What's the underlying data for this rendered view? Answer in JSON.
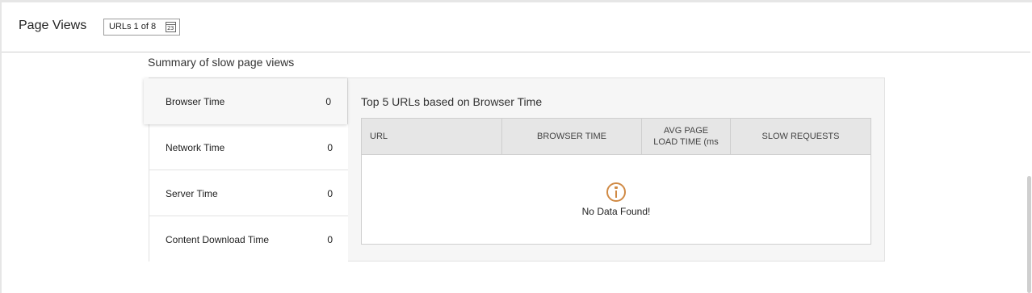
{
  "header": {
    "title": "Page Views",
    "url_selector": "URLs 1 of 8",
    "calendar_icon": "calendar-icon"
  },
  "summary": {
    "title": "Summary of slow page views",
    "metrics": [
      {
        "label": "Browser Time",
        "value": "0",
        "active": true
      },
      {
        "label": "Network Time",
        "value": "0"
      },
      {
        "label": "Server Time",
        "value": "0"
      },
      {
        "label": "Content Download Time",
        "value": "0"
      }
    ]
  },
  "table": {
    "title": "Top 5 URLs based on Browser Time",
    "columns": [
      "URL",
      "BROWSER TIME",
      "AVG PAGE\nLOAD TIME (ms",
      "SLOW REQUESTS"
    ],
    "rows": [],
    "empty_message": "No Data Found!",
    "empty_icon": "info-icon"
  },
  "colors": {
    "accent_info": "#d08a45",
    "header_bg": "#e6e6e6"
  }
}
